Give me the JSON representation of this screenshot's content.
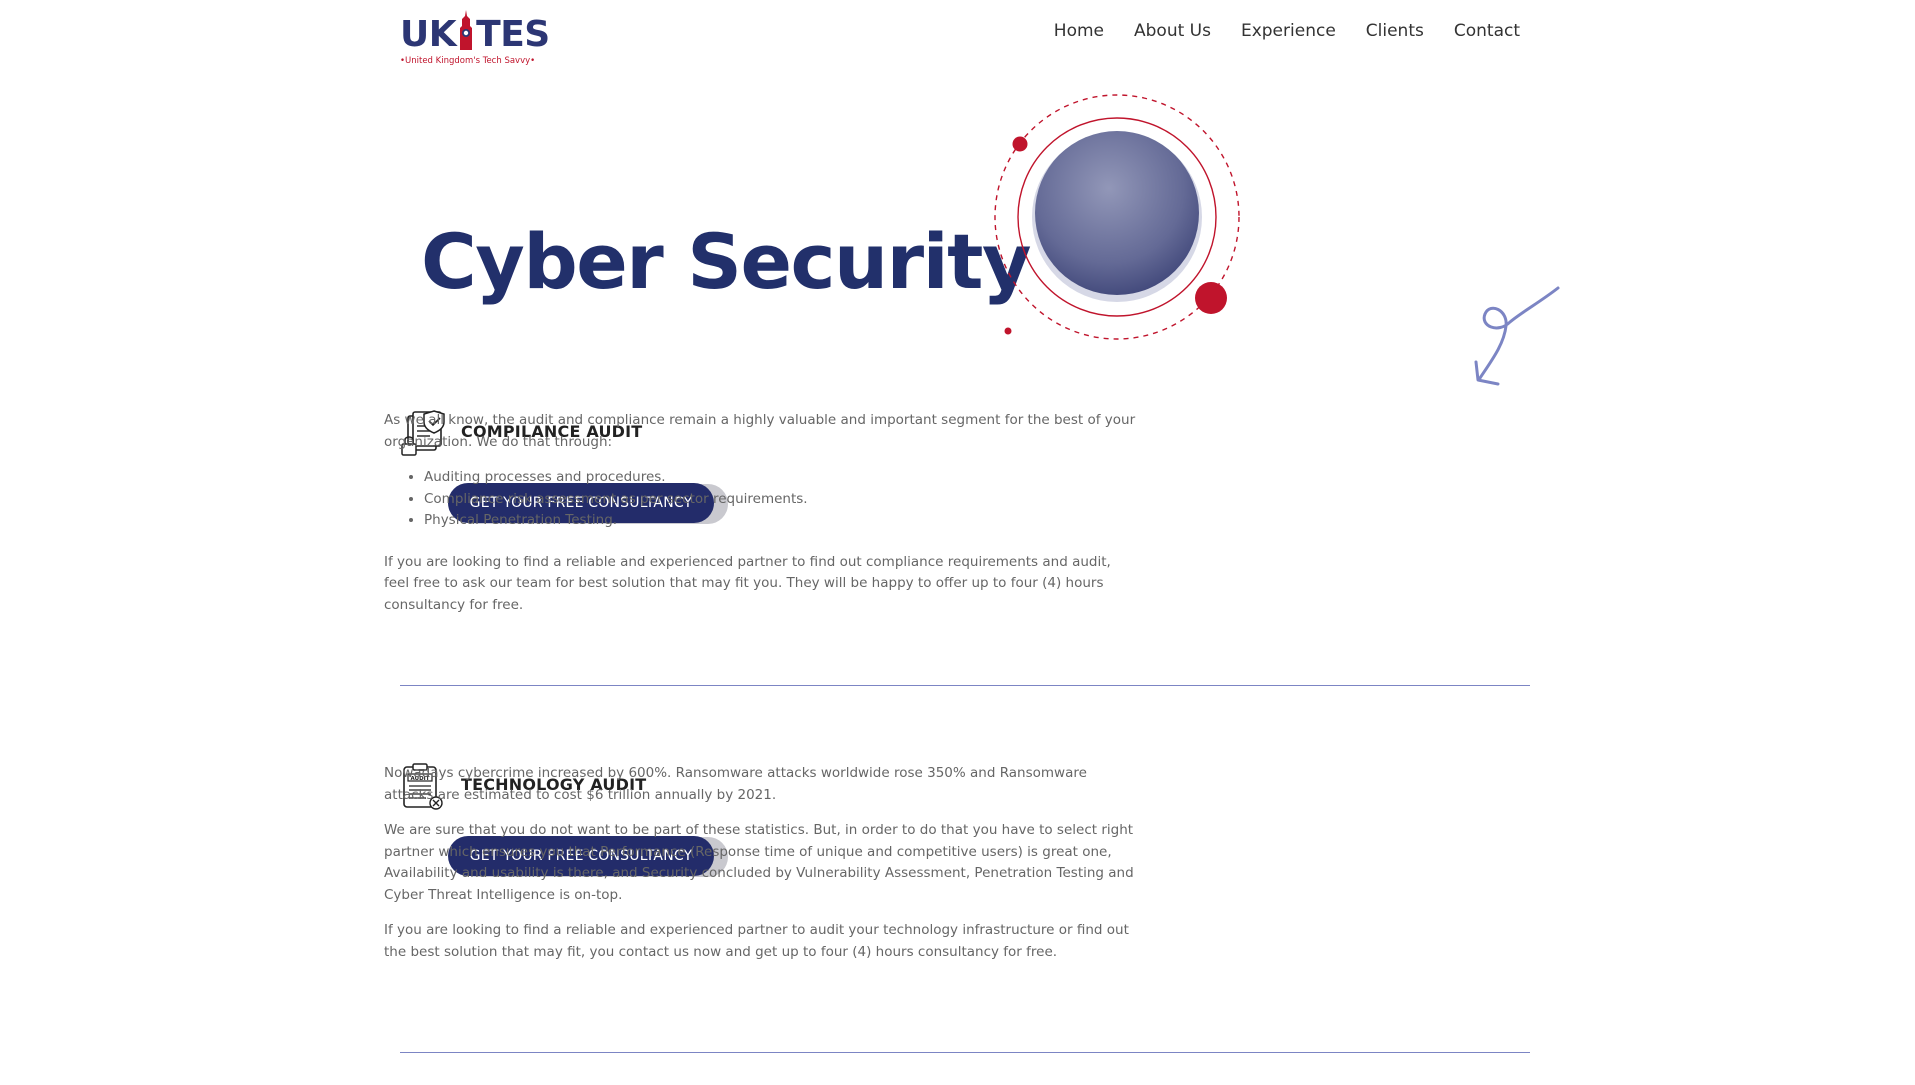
{
  "header": {
    "logo_text_left": "UK",
    "logo_text_right": "TES",
    "logo_tagline": "•United Kingdom's Tech Savvy•",
    "nav": [
      "Home",
      "About Us",
      "Experience",
      "Clients",
      "Contact"
    ]
  },
  "hero": {
    "title": "Cyber Security"
  },
  "sections": [
    {
      "icon": "compliance-document-shield-icon",
      "title": "COMPILANCE AUDIT",
      "cta": "GET YOUR FREE CONSULTANCY",
      "intro": "As we all know, the audit and compliance remain a highly valuable and important segment for the best of your organization. We do that through:",
      "bullets": [
        "Auditing processes and procedures.",
        "Compliance risk assessment as per sector requirements.",
        "Physical Penetration Testing."
      ],
      "outro": "If you are looking to find a reliable and experienced partner to find out compliance requirements and audit, feel free to ask our team for best solution that may fit you. They will be happy to offer up to four (4) hours consultancy for free."
    },
    {
      "icon": "audit-clipboard-icon",
      "title": "TECHNOLOGY AUDIT",
      "cta": "GET YOUR FREE CONSULTANCY",
      "p1": "Nowadays cybercrime increased by 600%. Ransomware attacks worldwide rose 350% and Ransomware attacks are estimated to cost $6 trillion annually by 2021.",
      "p2": "We are sure that you do not want to be part of these statistics. But, in order to do that you have to select right partner which ensures you that Performance (Response time of unique and competitive users) is great one, Availability and usability is there, and Security concluded by Vulnerability Assessment, Penetration Testing and Cyber Threat Intelligence is on-top.",
      "p3": "If you are looking to find a reliable and experienced partner to audit your technology infrastructure or find out the best solution that may fit, you contact us now and get up to four (4) hours consultancy for free."
    }
  ],
  "colors": {
    "navy": "#232c6a",
    "brand_red": "#c0142c",
    "divider": "#7c85c4",
    "text_muted": "#666666"
  }
}
